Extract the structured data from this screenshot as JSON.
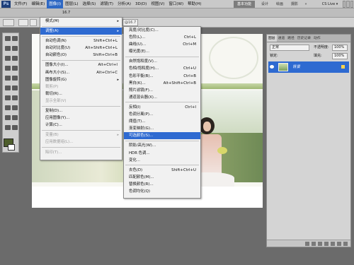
{
  "app": {
    "logo": "Ps",
    "zoom": "16.7",
    "workspaces": [
      "基本功能",
      "设计",
      "绘画",
      "摄影"
    ],
    "workspace_more": "»",
    "cslive": "CS Live ▾"
  },
  "menubar": [
    "文件(F)",
    "编辑(E)",
    "图像(I)",
    "图层(L)",
    "选择(S)",
    "滤镜(T)",
    "分析(A)",
    "3D(D)",
    "视图(V)",
    "窗口(W)",
    "帮助(H)"
  ],
  "document_tab": "@16.7",
  "image_menu": {
    "items": [
      {
        "label": "模式(M)",
        "shortcut": "",
        "submenu": true,
        "disabled": false,
        "highlighted": false,
        "sep_after": true
      },
      {
        "label": "调整(A)",
        "shortcut": "",
        "submenu": true,
        "disabled": false,
        "highlighted": true,
        "sep_after": true
      },
      {
        "label": "自动色调(N)",
        "shortcut": "Shift+Ctrl+L",
        "disabled": false
      },
      {
        "label": "自动对比度(U)",
        "shortcut": "Alt+Shift+Ctrl+L",
        "disabled": false
      },
      {
        "label": "自动颜色(O)",
        "shortcut": "Shift+Ctrl+B",
        "disabled": false,
        "sep_after": true
      },
      {
        "label": "图像大小(I)...",
        "shortcut": "Alt+Ctrl+I",
        "disabled": false
      },
      {
        "label": "画布大小(S)...",
        "shortcut": "Alt+Ctrl+C",
        "disabled": false
      },
      {
        "label": "图像旋转(G)",
        "shortcut": "",
        "submenu": true,
        "disabled": false
      },
      {
        "label": "裁剪(P)",
        "shortcut": "",
        "disabled": true
      },
      {
        "label": "裁切(R)...",
        "shortcut": "",
        "disabled": false
      },
      {
        "label": "显示全部(V)",
        "shortcut": "",
        "disabled": true,
        "sep_after": true
      },
      {
        "label": "复制(D)...",
        "shortcut": "",
        "disabled": false
      },
      {
        "label": "应用图像(Y)...",
        "shortcut": "",
        "disabled": false
      },
      {
        "label": "计算(C)...",
        "shortcut": "",
        "disabled": false,
        "sep_after": true
      },
      {
        "label": "变量(B)",
        "shortcut": "",
        "submenu": true,
        "disabled": true
      },
      {
        "label": "应用数据组(L)...",
        "shortcut": "",
        "disabled": true,
        "sep_after": true
      },
      {
        "label": "陷印(T)...",
        "shortcut": "",
        "disabled": true
      }
    ]
  },
  "adjust_menu": {
    "items": [
      {
        "label": "亮度/对比度(C)...",
        "shortcut": ""
      },
      {
        "label": "色阶(L)...",
        "shortcut": "Ctrl+L"
      },
      {
        "label": "曲线(U)...",
        "shortcut": "Ctrl+M"
      },
      {
        "label": "曝光度(E)...",
        "shortcut": "",
        "sep_after": true
      },
      {
        "label": "自然饱和度(V)...",
        "shortcut": ""
      },
      {
        "label": "色相/饱和度(H)...",
        "shortcut": "Ctrl+U"
      },
      {
        "label": "色彩平衡(B)...",
        "shortcut": "Ctrl+B"
      },
      {
        "label": "黑白(K)...",
        "shortcut": "Alt+Shift+Ctrl+B"
      },
      {
        "label": "照片滤镜(F)...",
        "shortcut": ""
      },
      {
        "label": "通道混合器(X)...",
        "shortcut": "",
        "sep_after": true
      },
      {
        "label": "反相(I)",
        "shortcut": "Ctrl+I"
      },
      {
        "label": "色调分离(P)...",
        "shortcut": ""
      },
      {
        "label": "阈值(T)...",
        "shortcut": ""
      },
      {
        "label": "渐变映射(G)...",
        "shortcut": ""
      },
      {
        "label": "可选颜色(S)...",
        "shortcut": "",
        "highlighted": true,
        "sep_after": true
      },
      {
        "label": "阴影/高光(W)...",
        "shortcut": ""
      },
      {
        "label": "HDR 色调...",
        "shortcut": ""
      },
      {
        "label": "变化...",
        "shortcut": "",
        "sep_after": true
      },
      {
        "label": "去色(D)",
        "shortcut": "Shift+Ctrl+U"
      },
      {
        "label": "匹配颜色(M)...",
        "shortcut": ""
      },
      {
        "label": "替换颜色(R)...",
        "shortcut": ""
      },
      {
        "label": "色调均化(Q)",
        "shortcut": ""
      }
    ]
  },
  "layers_panel": {
    "tabs": [
      "图层",
      "通道",
      "路径",
      "历史记录",
      "动作"
    ],
    "blend_mode": "正常",
    "opacity_label": "不透明度:",
    "opacity": "100%",
    "lock_label": "锁定:",
    "fill_label": "填充:",
    "fill": "100%",
    "layer_name": "背景"
  },
  "colors": {
    "accent": "#2e6ad1",
    "foreground_swatch": "#4e5e2c",
    "background_swatch": "#ffffff"
  }
}
